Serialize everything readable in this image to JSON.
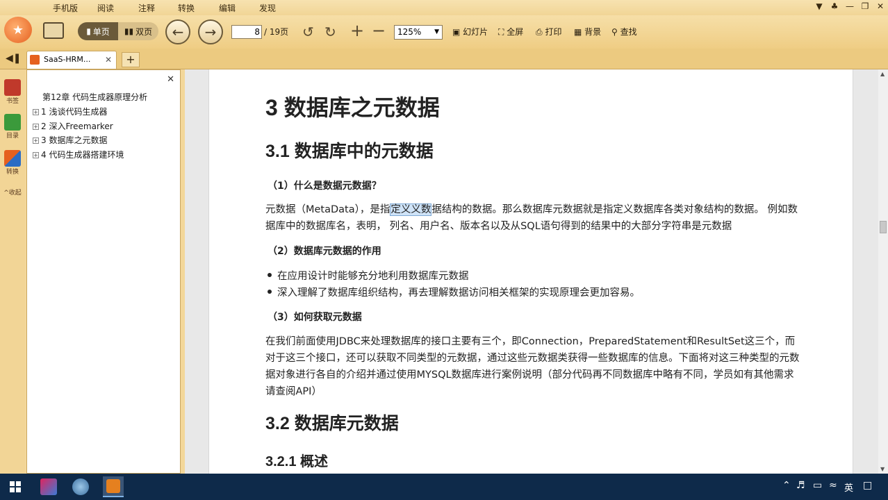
{
  "menu": [
    "手机版",
    "阅读",
    "注释",
    "转换",
    "编辑",
    "发现"
  ],
  "toolbar": {
    "single_page": "单页",
    "double_page": "双页",
    "page_current": "8",
    "page_total": "/ 19页",
    "zoom": "125%",
    "slideshow": "幻灯片",
    "fullscreen": "全屏",
    "print": "打印",
    "background": "背景",
    "find": "查找"
  },
  "tab": {
    "title": "SaaS-HRM..."
  },
  "leftcol": {
    "bookmark": "书签",
    "toc": "目录",
    "convert": "转换",
    "collapse": "收起"
  },
  "sidebar": {
    "items": [
      {
        "label": "第12章 代码生成器原理分析"
      },
      {
        "label": "1 浅谈代码生成器"
      },
      {
        "label": "2 深入Freemarker"
      },
      {
        "label": "3 数据库之元数据"
      },
      {
        "label": "4 代码生成器搭建环境"
      }
    ]
  },
  "doc": {
    "h1": "3 数据库之元数据",
    "h2a": "3.1 数据库中的元数据",
    "sub1": "（1）什么是数据元数据？",
    "p1_pre": "元数据（MetaData），是指",
    "p1_hl": "定义义数",
    "p1_post": "据结构的数据。那么数据库元数据就是指定义数据库各类对象结构的数据。 例如数据库中的数据库名，表明， 列名、用户名、版本名以及从SQL语句得到的结果中的大部分字符串是元数据",
    "sub2": "（2）数据库元数据的作用",
    "bullets": [
      "在应用设计时能够充分地利用数据库元数据",
      "深入理解了数据库组织结构，再去理解数据访问相关框架的实现原理会更加容易。"
    ],
    "sub3": "（3）如何获取元数据",
    "p2": "在我们前面使用JDBC来处理数据库的接口主要有三个，即Connection，PreparedStatement和ResultSet这三个，而对于这三个接口，还可以获取不同类型的元数据，通过这些元数据类获得一些数据库的信息。下面将对这三种类型的元数据对象进行各自的介绍并通过使用MYSQL数据库进行案例说明（部分代码再不同数据库中略有不同，学员如有其他需求请查阅API）",
    "h2b": "3.2 数据库元数据",
    "h3": "3.2.1 概述"
  },
  "taskbar": {
    "ime": "英"
  }
}
